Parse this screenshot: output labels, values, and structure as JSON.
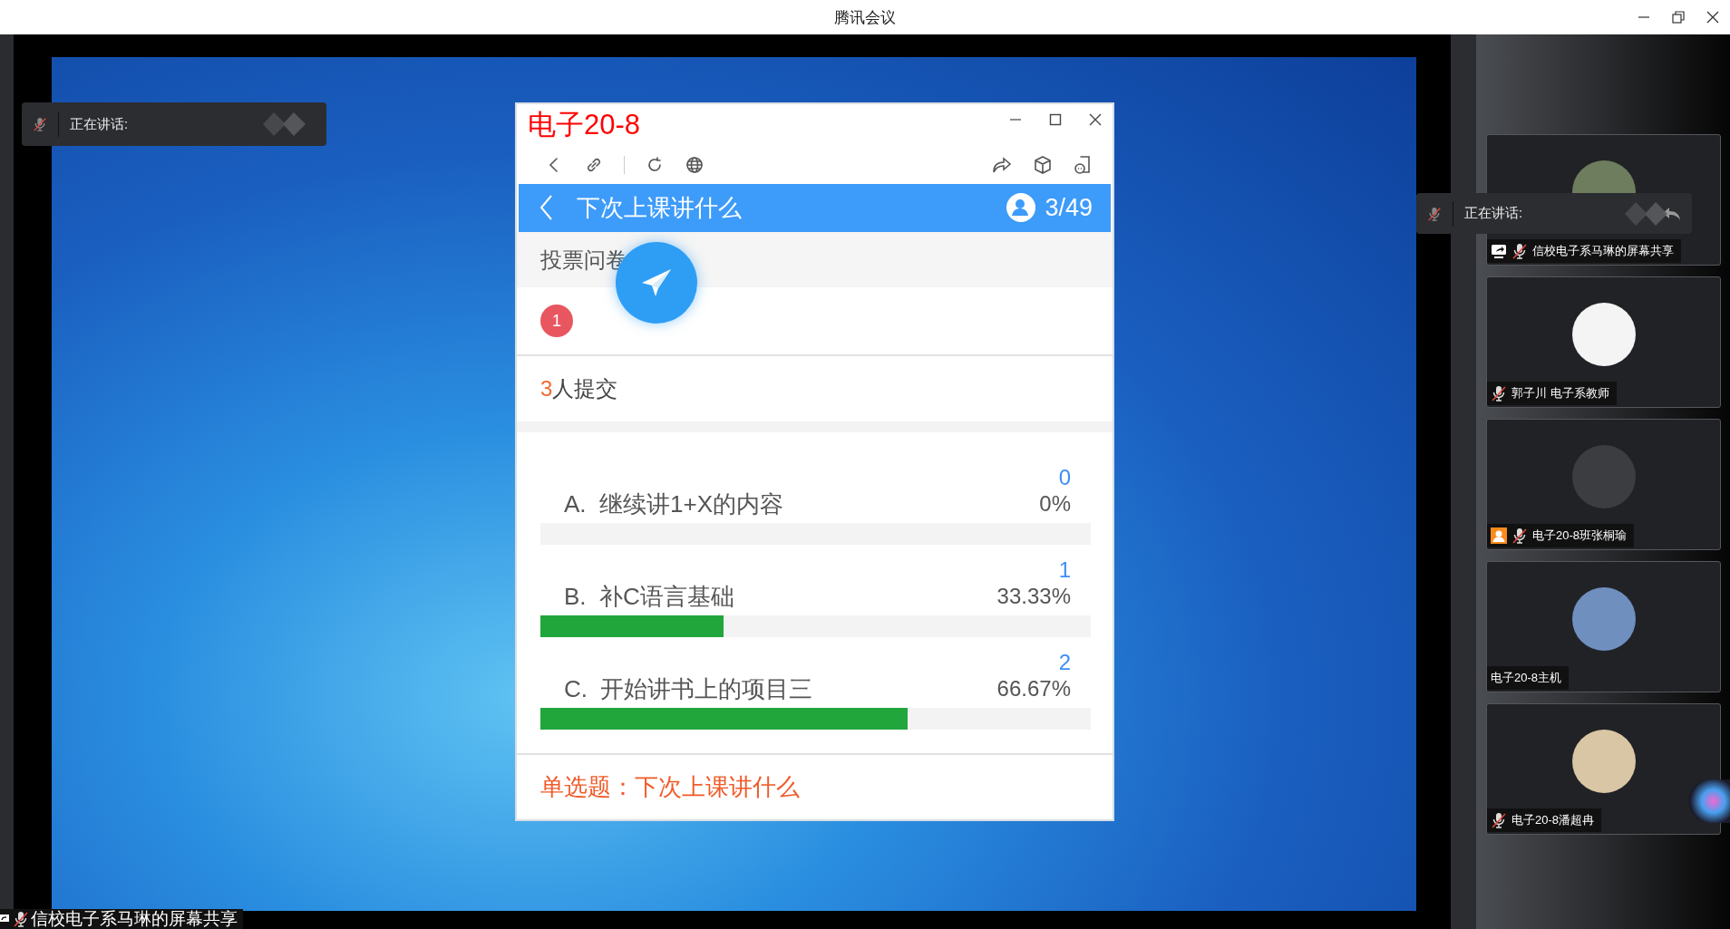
{
  "window": {
    "title": "腾讯会议"
  },
  "speaking_indicators": [
    {
      "label": "正在讲话:",
      "reply": false
    },
    {
      "label": "正在讲话:",
      "reply": true
    }
  ],
  "shared_window": {
    "title": "电子20-8",
    "page_title": "下次上课讲什么",
    "participants_count": "3/49",
    "section": "投票问卷",
    "badge": "1",
    "submitted": {
      "count": "3",
      "suffix": "人提交"
    },
    "options": [
      {
        "letter": "A.",
        "text": "继续讲1+X的内容",
        "votes": "0",
        "percent": "0%",
        "level": 0
      },
      {
        "letter": "B.",
        "text": "补C语言基础",
        "votes": "1",
        "percent": "33.33%",
        "level": 0.3333
      },
      {
        "letter": "C.",
        "text": "开始讲书上的项目三",
        "votes": "2",
        "percent": "66.67%",
        "level": 0.6667
      }
    ],
    "question": "单选题：下次上课讲什么"
  },
  "participants": [
    {
      "name": "信校电子系马琳的屏幕共享",
      "kind": "screen_share",
      "muted": true
    },
    {
      "name": "郭子川 电子系教师",
      "kind": "member",
      "muted": true
    },
    {
      "name": "电子20-8班张桐瑜",
      "kind": "guest",
      "muted": true
    },
    {
      "name": "电子20-8主机",
      "kind": "member",
      "muted": false
    },
    {
      "name": "电子20-8潘超冉",
      "kind": "member",
      "muted": true
    }
  ],
  "share_label": {
    "text": "信校电子系马琳的屏幕共享",
    "muted": true
  }
}
